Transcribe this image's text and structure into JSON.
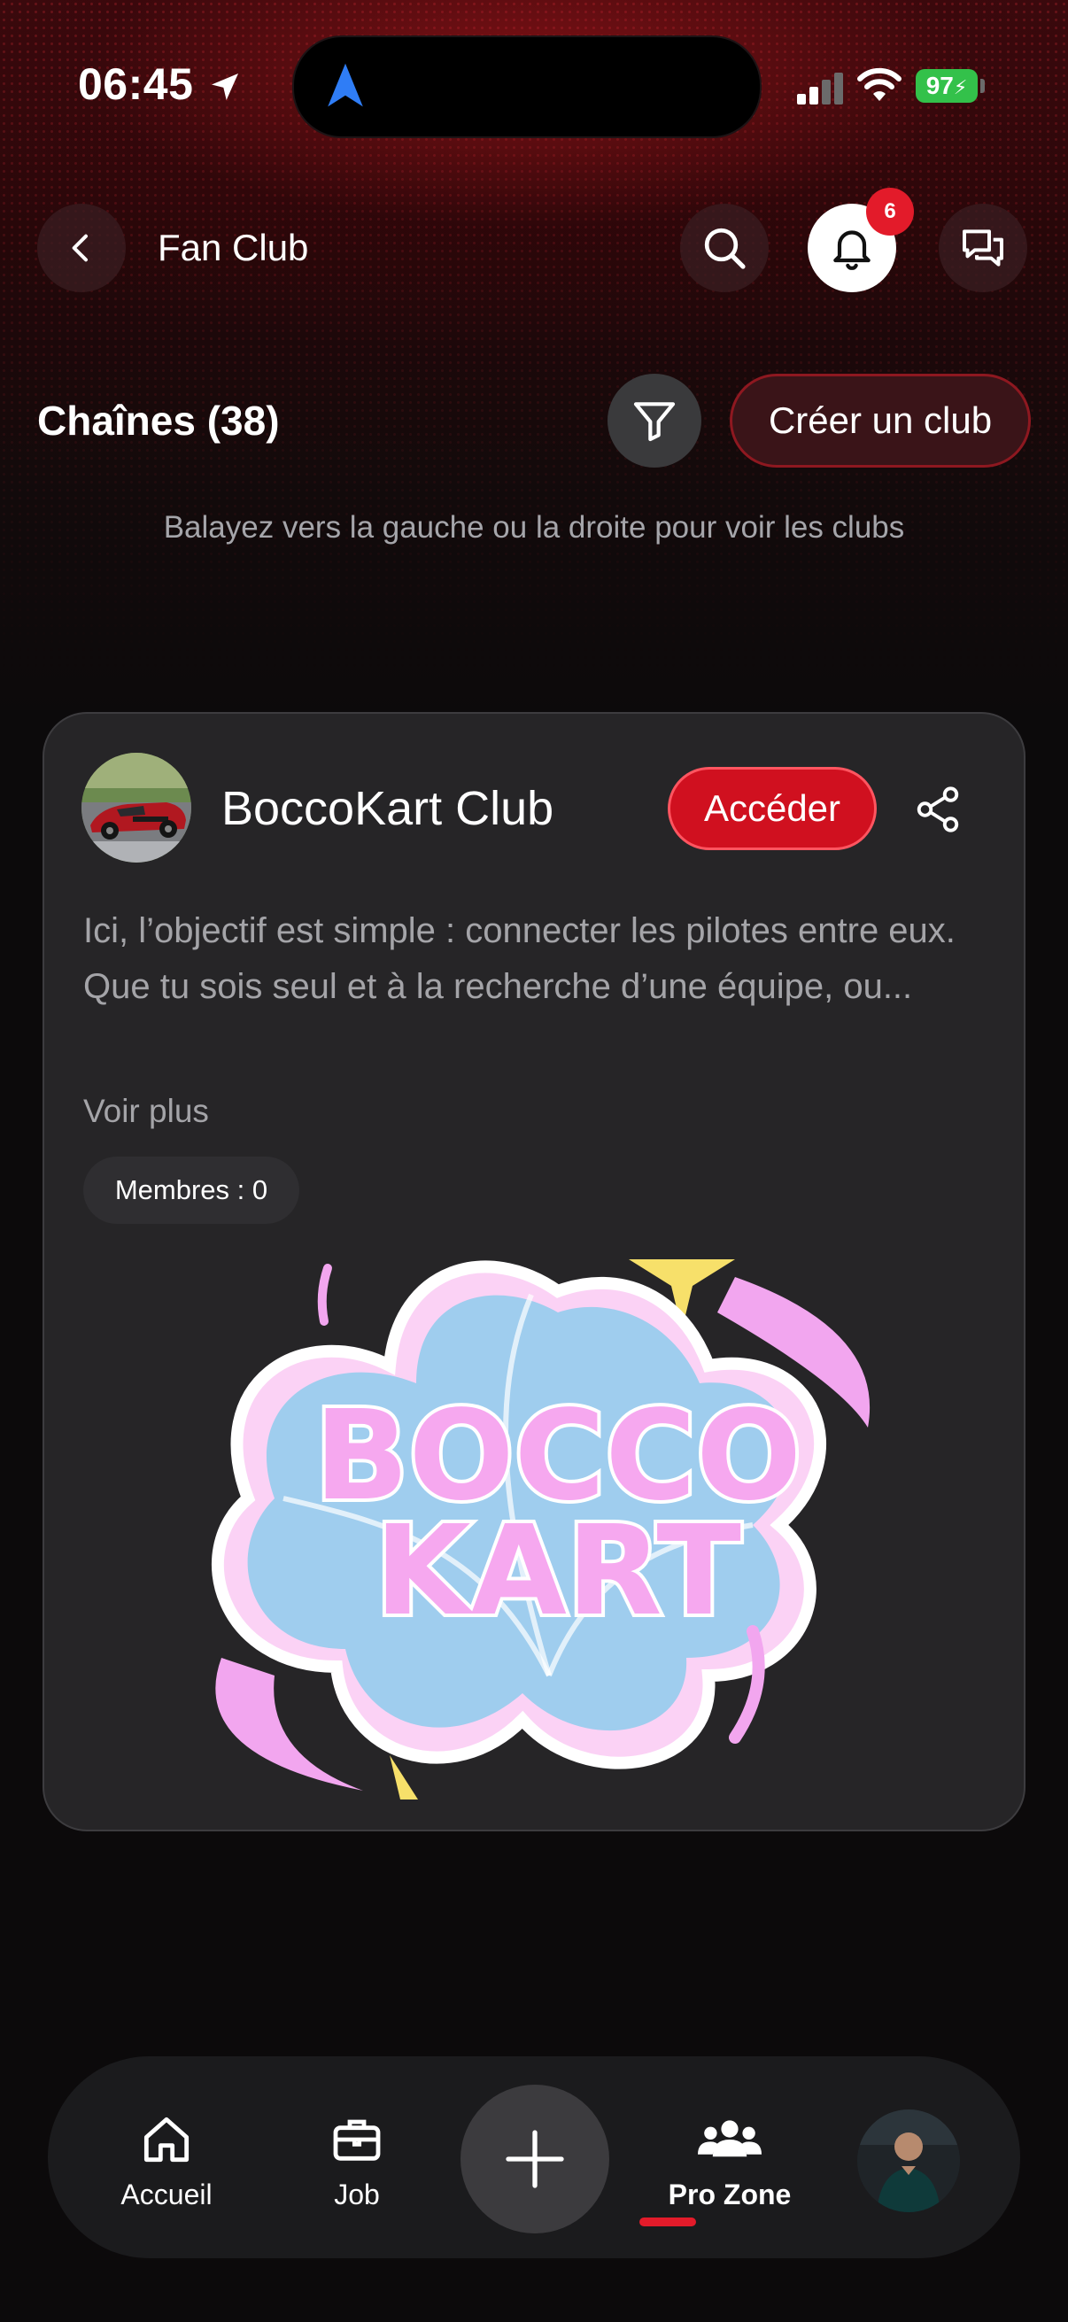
{
  "status_bar": {
    "time": "06:45",
    "battery": "97"
  },
  "header": {
    "title": "Fan Club",
    "notification_count": "6",
    "icons": [
      "chevron-left-icon",
      "search-icon",
      "bell-icon",
      "chat-icon"
    ]
  },
  "channels": {
    "title": "Chaînes (38)",
    "create_button": "Créer un club",
    "hint": "Balayez vers la gauche ou la droite pour voir les clubs"
  },
  "club_card": {
    "name": "BoccoKart Club",
    "access_button": "Accéder",
    "description": "Ici, l’objectif est simple : connecter les pilotes entre eux.\nQue tu sois seul et à la recherche d’une équipe, ou...",
    "see_more": "Voir plus",
    "members": "Membres : 0",
    "logo_text_line1": "BOCCO",
    "logo_text_line2": "KART"
  },
  "bottom_nav": {
    "items": [
      {
        "label": "Accueil",
        "icon": "home-icon"
      },
      {
        "label": "Job",
        "icon": "briefcase-icon"
      },
      {
        "label": "Pro Zone",
        "icon": "group-icon",
        "active": true
      }
    ],
    "center_icon": "plus-icon"
  },
  "colors": {
    "accent": "#e31b2a",
    "card_bg": "#262527",
    "battery": "#33c14a"
  }
}
